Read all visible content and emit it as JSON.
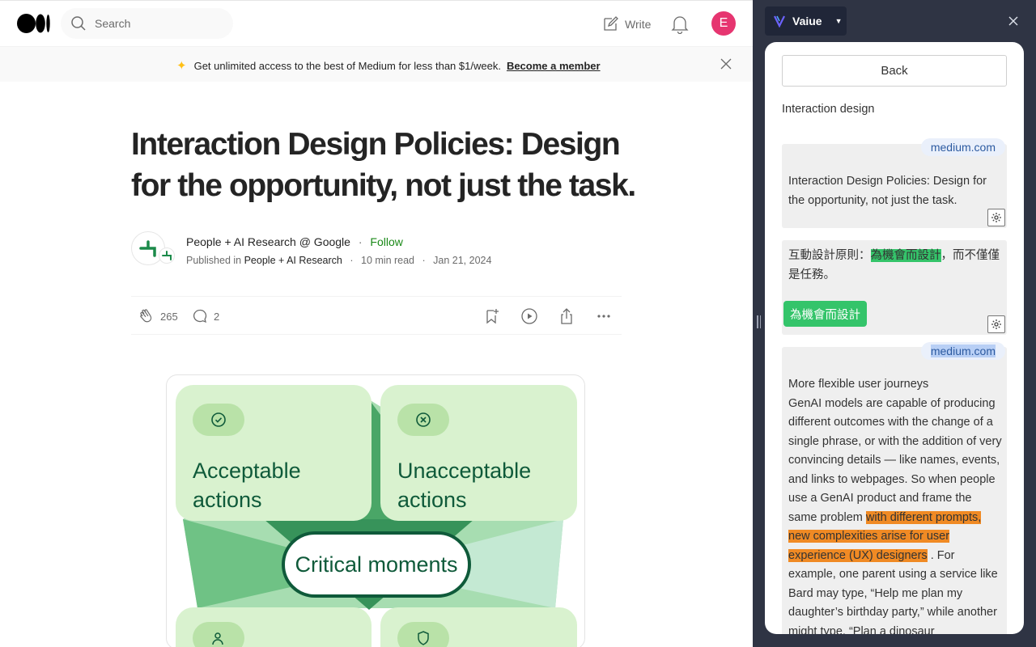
{
  "medium": {
    "search_placeholder": "Search",
    "write_label": "Write",
    "avatar_letter": "E",
    "banner": {
      "text": "Get unlimited access to the best of Medium for less than $1/week.",
      "link": "Become a member"
    },
    "article": {
      "title": "Interaction Design Policies: Design for the opportunity, not just the task.",
      "author": "People + AI Research @ Google",
      "follow": "Follow",
      "published_in_label": "Published in",
      "publication": "People + AI Research",
      "read_time": "10 min read",
      "date": "Jan 21, 2024",
      "claps": "265",
      "comments": "2"
    },
    "figure": {
      "card1": "Acceptable actions",
      "card2": "Unacceptable actions",
      "center": "Critical moments"
    }
  },
  "extension": {
    "brand": "Vaiue",
    "back_label": "Back",
    "panel_title": "Interaction design",
    "blocks": [
      {
        "tag": "medium.com",
        "text": "Interaction Design Policies: Design for the opportunity, not just the task."
      },
      {
        "text_before": "互動設計原則：",
        "highlight": "為機會而設計",
        "text_after": "，而不僅僅是任務。",
        "button": "為機會而設計"
      },
      {
        "tag": "medium.com",
        "heading": "More flexible user journeys",
        "text_before": "GenAI models are capable of producing different outcomes with the change of a single phrase, or with the addition of very convincing details — like names, events, and links to webpages. So when people use a GenAI product and frame the same problem",
        "highlight": "with different prompts, new complexities arise for user experience (UX) designers",
        "text_after": ". For example, one parent using a service like Bard may type, “Help me plan my daughter’s birthday party,” while another might type, “Plan a dinosaur"
      }
    ]
  },
  "colors": {
    "accent_green": "#1a8917",
    "extension_bg": "#2f3444",
    "highlight_green": "#34c46a",
    "highlight_orange": "#f08a24"
  }
}
